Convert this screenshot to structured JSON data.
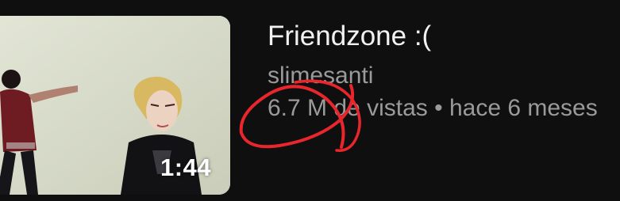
{
  "video": {
    "title": "Friendzone :(",
    "channel": "slimesanti",
    "views": "6.7 M de vistas",
    "separator": "•",
    "age": "hace 6 meses",
    "duration": "1:44"
  },
  "thumbnail": {
    "subject": "two people in a white studio",
    "background_color": "#d9dcc9"
  },
  "annotation": {
    "type": "hand-drawn circle",
    "color": "#e8262b"
  },
  "colors": {
    "background": "#0f0f0f",
    "title": "#f1f1f1",
    "secondary_text": "#9a9a9a"
  }
}
